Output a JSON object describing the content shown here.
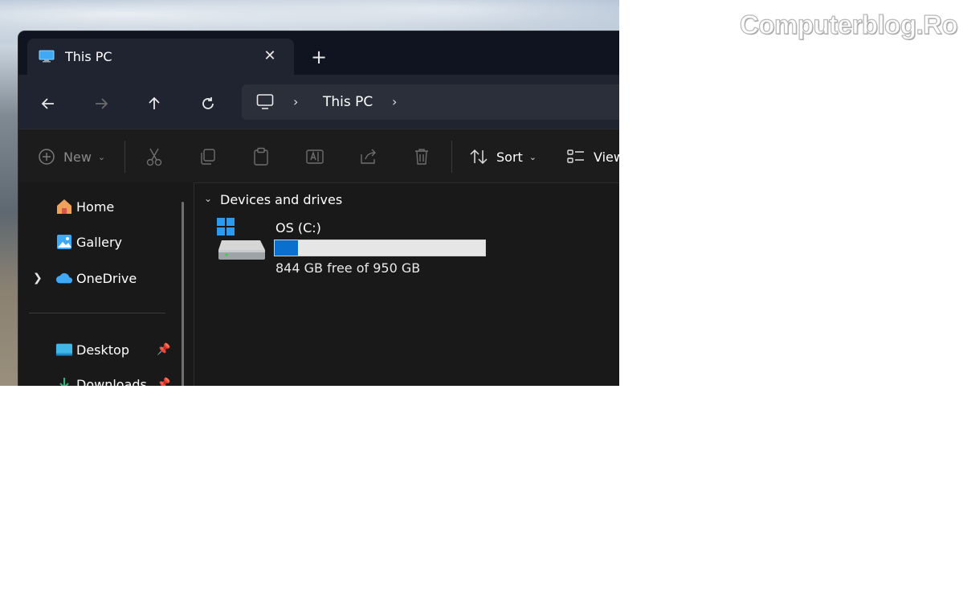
{
  "watermark": {
    "text": "Computerblog.Ro"
  },
  "window": {
    "tab": {
      "title": "This PC",
      "icon": "monitor-icon",
      "close_icon": "close-icon"
    },
    "new_tab_icon": "plus-icon"
  },
  "navigation": {
    "back_icon": "arrow-left-icon",
    "forward_icon": "arrow-right-icon",
    "up_icon": "arrow-up-icon",
    "refresh_icon": "refresh-icon",
    "address": {
      "icon": "pc-icon",
      "path": [
        "This PC"
      ]
    }
  },
  "toolbar": {
    "new_label": "New",
    "sort_label": "Sort",
    "view_label": "View",
    "icons": [
      "plus-circle-icon",
      "cut-icon",
      "copy-icon",
      "paste-icon",
      "rename-icon",
      "share-icon",
      "delete-icon",
      "sort-icon",
      "view-icon"
    ]
  },
  "sidebar": {
    "items": [
      {
        "label": "Home",
        "icon": "home-icon"
      },
      {
        "label": "Gallery",
        "icon": "gallery-icon"
      },
      {
        "label": "OneDrive",
        "icon": "onedrive-icon",
        "expandable": true
      }
    ],
    "pinned": [
      {
        "label": "Desktop",
        "icon": "desktop-folder-icon",
        "pinned": true
      },
      {
        "label": "Downloads",
        "icon": "downloads-icon",
        "pinned": true
      }
    ]
  },
  "main": {
    "group_title": "Devices and drives",
    "drives": [
      {
        "name": "OS (C:)",
        "free_text": "844 GB free of 950 GB",
        "used_fraction": 0.11,
        "bar_color": "#0a6fcf"
      }
    ]
  },
  "colors": {
    "accent": "#0a6fcf",
    "window_bg": "#191919",
    "titlebar_bg": "#0f1420"
  }
}
